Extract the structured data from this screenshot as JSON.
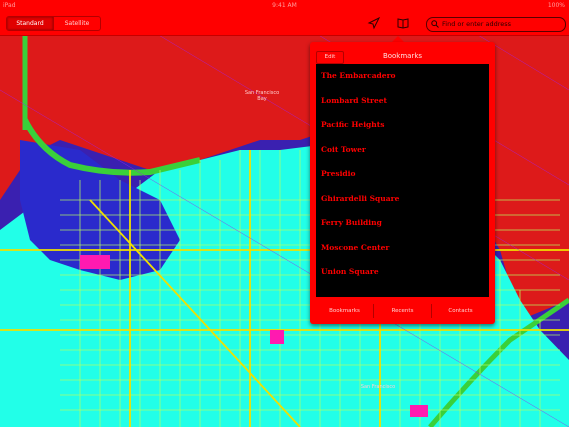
{
  "status_bar": {
    "carrier": "iPad",
    "time": "9:41 AM",
    "battery": "100%"
  },
  "toolbar": {
    "segments": [
      "Standard",
      "Satellite"
    ],
    "active_segment": "Standard",
    "location_icon": "location-arrow-icon",
    "bookmarks_icon": "book-icon",
    "search_value": "Find or enter address"
  },
  "popover": {
    "title": "Bookmarks",
    "back_label": "Edit",
    "items": [
      "The Embarcadero",
      "Lombard Street",
      "Pacific Heights",
      "Coit Tower",
      "Presidio",
      "Ghirardelli Square",
      "Ferry Building",
      "Moscone Center",
      "Union Square"
    ],
    "tabs": [
      "Bookmarks",
      "Recents",
      "Contacts"
    ]
  },
  "map_labels": {
    "bay": "San Francisco Bay",
    "downtown": "San Francisco"
  },
  "colors": {
    "bar": "#ff0000",
    "water": "#2222aa",
    "land": "#22ffe8",
    "park": "#f0e000",
    "road": "#b8ff60",
    "list_bg": "#000000"
  }
}
